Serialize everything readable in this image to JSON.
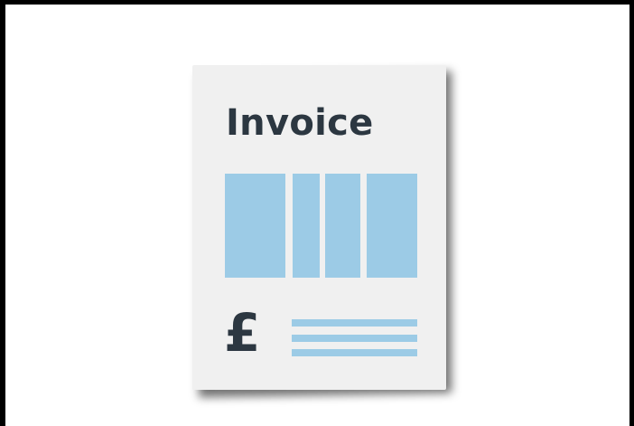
{
  "invoice_icon": {
    "title": "Invoice",
    "currency_symbol": "£",
    "colors": {
      "page": "#f0f0f0",
      "text": "#2c3741",
      "accent": "#9ccbe6",
      "frame_border": "#000000"
    },
    "icon_name": "invoice-document-icon"
  }
}
